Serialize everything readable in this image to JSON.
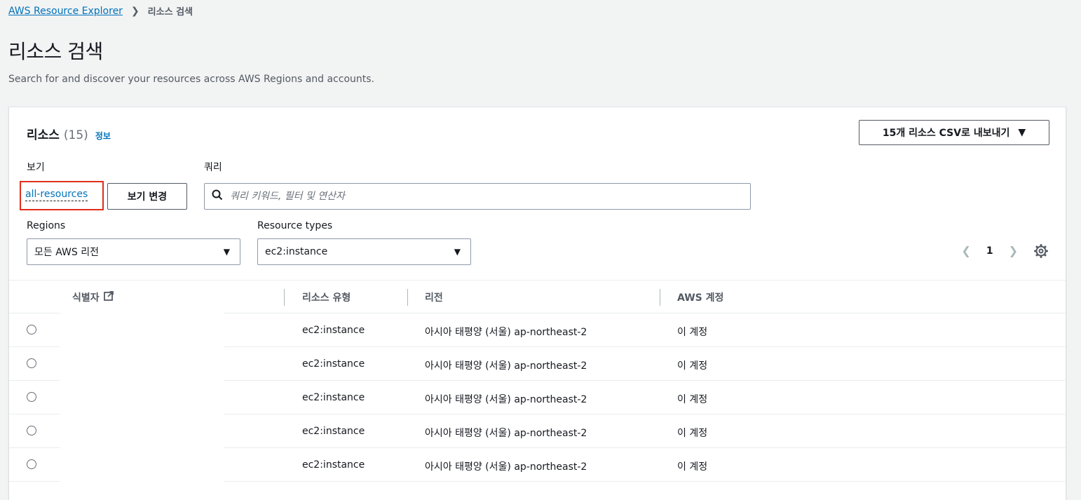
{
  "breadcrumb": {
    "root": "AWS Resource Explorer",
    "current": "리소스 검색"
  },
  "page": {
    "title": "리소스 검색",
    "description": "Search for and discover your resources across AWS Regions and accounts."
  },
  "panel": {
    "title": "리소스",
    "count": "(15)",
    "info": "정보",
    "export_button": "15개 리소스 CSV로 내보내기",
    "view_label": "보기",
    "view_value": "all-resources",
    "change_view_button": "보기 변경",
    "query_label": "쿼리",
    "query_placeholder": "쿼리 키워드, 필터 및 연산자",
    "regions_label": "Regions",
    "regions_value": "모든 AWS 리전",
    "types_label": "Resource types",
    "types_value": "ec2:instance",
    "page_number": "1"
  },
  "table": {
    "columns": [
      "식별자",
      "리소스 유형",
      "리전",
      "AWS 계정"
    ],
    "rows": [
      {
        "identifier": "",
        "type": "ec2:instance",
        "region": "아시아 태평양 (서울) ap-northeast-2",
        "account": "이 계정"
      },
      {
        "identifier": "",
        "type": "ec2:instance",
        "region": "아시아 태평양 (서울) ap-northeast-2",
        "account": "이 계정"
      },
      {
        "identifier": "",
        "type": "ec2:instance",
        "region": "아시아 태평양 (서울) ap-northeast-2",
        "account": "이 계정"
      },
      {
        "identifier": "",
        "type": "ec2:instance",
        "region": "아시아 태평양 (서울) ap-northeast-2",
        "account": "이 계정"
      },
      {
        "identifier": "",
        "type": "ec2:instance",
        "region": "아시아 태평양 (서울) ap-northeast-2",
        "account": "이 계정"
      }
    ]
  },
  "colors": {
    "link": "#0073bb",
    "highlight": "#e02d1b",
    "background": "#f2f3f3"
  }
}
